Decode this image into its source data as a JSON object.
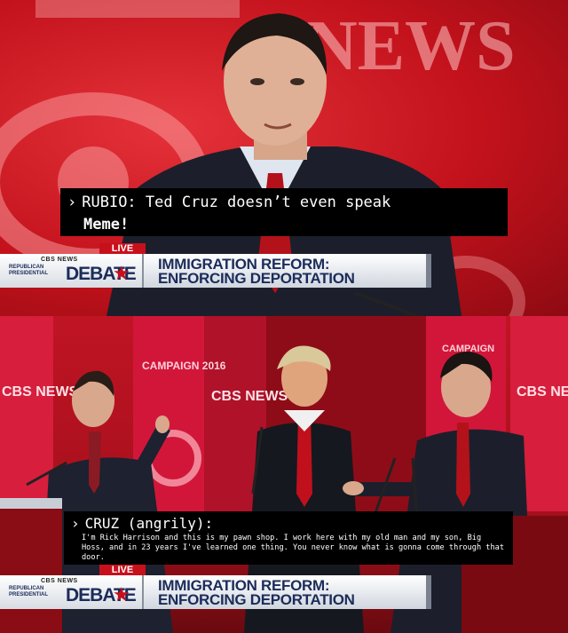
{
  "top_panel": {
    "background_text": "NEWS",
    "caption": {
      "speaker": "RUBIO:",
      "line1_text": "Ted Cruz doesn’t even speak",
      "line2_text": "Meme!"
    },
    "lower_third": {
      "live_label": "LIVE",
      "network_label": "CBS NEWS",
      "event_small": "REPUBLICAN PRESIDENTIAL",
      "event_large": "DEBATE",
      "headline_line1": "IMMIGRATION REFORM:",
      "headline_line2": "ENFORCING DEPORTATION"
    }
  },
  "bottom_panel": {
    "backdrop_texts": [
      "CAMPAIGN 2016",
      "CBS NEWS",
      "CBS NEWS",
      "CBS NEWS",
      "CAMPAIGN"
    ],
    "caption": {
      "speaker": "CRUZ (angrily):",
      "quote": "I'm Rick Harrison and this is my pawn shop. I work here with my old man and my son, Big Hoss, and in 23 years I've learned one thing. You never know what is gonna come through that door."
    },
    "lower_third": {
      "live_label": "LIVE",
      "network_label": "CBS NEWS",
      "event_small": "REPUBLICAN PRESIDENTIAL",
      "event_large": "DEBATE",
      "headline_line1": "IMMIGRATION REFORM:",
      "headline_line2": "ENFORCING DEPORTATION"
    }
  },
  "colors": {
    "stage_red": "#c3121c",
    "caption_bg": "#000000",
    "banner_navy": "#1b2c5a"
  }
}
